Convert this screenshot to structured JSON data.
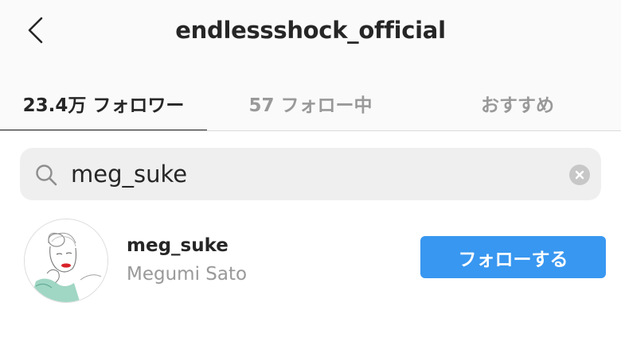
{
  "header": {
    "title": "endlessshock_official",
    "back_icon": "chevron-left-icon"
  },
  "tabs": [
    {
      "label": "23.4万 フォロワー",
      "active": true
    },
    {
      "label": "57 フォロー中",
      "active": false
    },
    {
      "label": "おすすめ",
      "active": false
    }
  ],
  "search": {
    "value": "meg_suke",
    "search_icon": "search-icon",
    "clear_icon": "clear-icon"
  },
  "results": [
    {
      "username": "meg_suke",
      "full_name": "Megumi Sato",
      "button_label": "フォローする"
    }
  ],
  "colors": {
    "accent": "#3897f0",
    "header_bg": "#fafafa",
    "search_bg": "#efefef",
    "muted_text": "#999999"
  }
}
